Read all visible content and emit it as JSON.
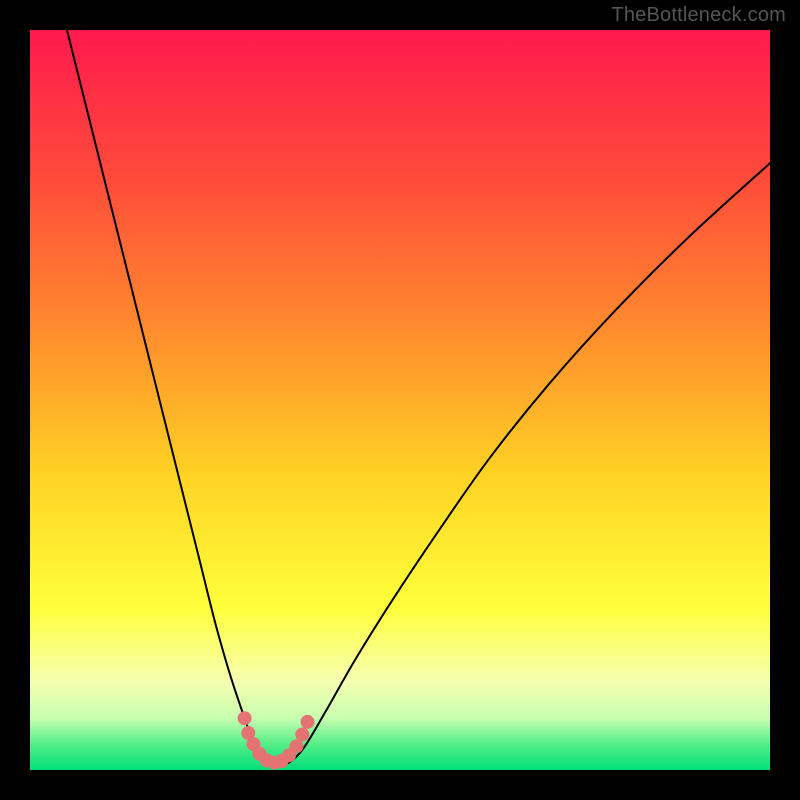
{
  "watermark": "TheBottleneck.com",
  "chart_data": {
    "type": "line",
    "title": "",
    "xlabel": "",
    "ylabel": "",
    "xlim": [
      0,
      100
    ],
    "ylim": [
      0,
      100
    ],
    "grid": false,
    "legend": false,
    "background_gradient_stops": [
      {
        "offset": 0.0,
        "color": "#ff1a4d"
      },
      {
        "offset": 0.2,
        "color": "#ff4b3a"
      },
      {
        "offset": 0.4,
        "color": "#ff8a2e"
      },
      {
        "offset": 0.6,
        "color": "#ffd224"
      },
      {
        "offset": 0.78,
        "color": "#ffff3b"
      },
      {
        "offset": 0.88,
        "color": "#f6ffb0"
      },
      {
        "offset": 0.93,
        "color": "#c8ffb0"
      },
      {
        "offset": 0.965,
        "color": "#55ee88"
      },
      {
        "offset": 1.0,
        "color": "#00e07a"
      }
    ],
    "series": [
      {
        "name": "bottleneck-curve",
        "stroke": "#000000",
        "stroke_width": 2,
        "x": [
          5,
          8,
          11,
          14,
          17,
          20,
          23,
          25,
          27,
          29,
          30.5,
          32,
          33.5,
          35,
          37,
          40,
          44,
          49,
          55,
          62,
          70,
          79,
          89,
          100
        ],
        "y": [
          100,
          88,
          76,
          64,
          52,
          40,
          28,
          20,
          13,
          7,
          3,
          1,
          0.5,
          1,
          3,
          8,
          15,
          23,
          32,
          42,
          52,
          62,
          72,
          82
        ]
      },
      {
        "name": "marker-dots",
        "type": "scatter",
        "color": "#e57373",
        "radius": 7,
        "x": [
          29.0,
          29.5,
          30.2,
          31.0,
          32.0,
          33.0,
          34.0,
          35.0,
          36.0,
          36.8,
          37.5
        ],
        "y": [
          7.0,
          5.0,
          3.5,
          2.2,
          1.3,
          1.0,
          1.2,
          2.0,
          3.2,
          4.8,
          6.5
        ]
      }
    ]
  }
}
